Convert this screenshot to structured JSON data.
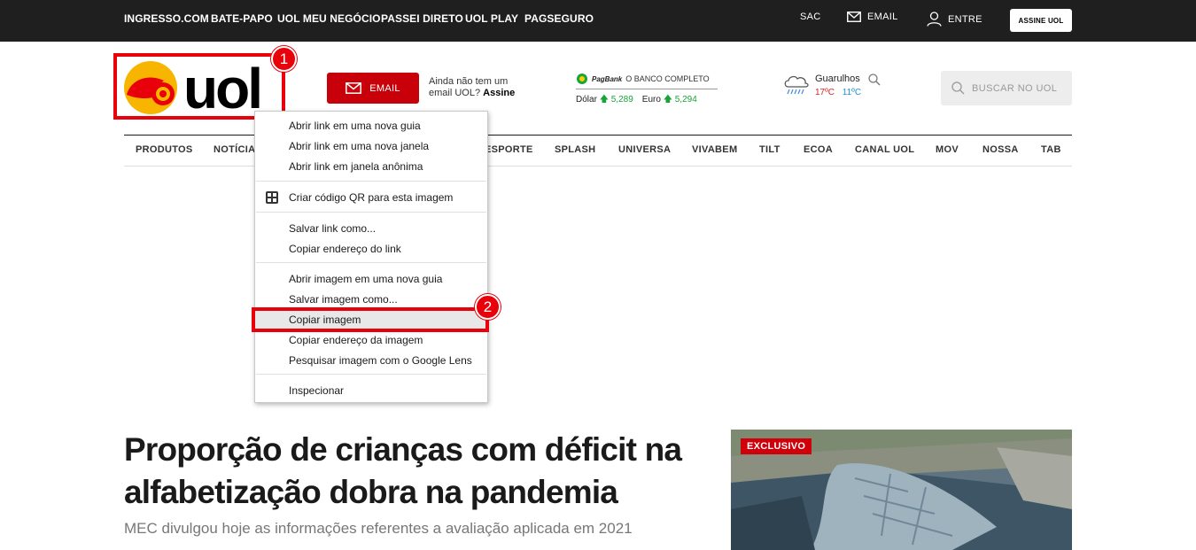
{
  "topbar": {
    "links": [
      "INGRESSO.COM",
      "BATE-PAPO",
      "UOL MEU NEGÓCIO",
      "PASSEI DIRETO",
      "UOL PLAY",
      "PAGSEGURO"
    ],
    "sac": "SAC",
    "email": "EMAIL",
    "entre": "ENTRE",
    "assine": "ASSINE UOL"
  },
  "header": {
    "logo_text": "uol",
    "email_button": "EMAIL",
    "email_promo_line1": "Ainda não tem um",
    "email_promo_line2": "email UOL?",
    "email_promo_cta": "Assine",
    "bank_brand": "PagBank",
    "bank_tagline": "O BANCO COMPLETO",
    "dolar_label": "Dólar",
    "dolar_value": "5,289",
    "euro_label": "Euro",
    "euro_value": "5,294",
    "weather_city": "Guarulhos",
    "temp_max": "17ºC",
    "temp_min": "11ºC",
    "search_label": "BUSCAR NO UOL"
  },
  "nav": [
    "PRODUTOS",
    "NOTÍCIA",
    "ESPORTE",
    "SPLASH",
    "UNIVERSA",
    "VIVABEM",
    "TILT",
    "ECOA",
    "CANAL UOL",
    "MOV",
    "NOSSA",
    "TAB"
  ],
  "article": {
    "headline": "Proporção de crianças com déficit na alfabetização dobra na pandemia",
    "subhead": "MEC divulgou hoje as informações referentes a avaliação aplicada em 2021",
    "tag": "EXCLUSIVO"
  },
  "context_menu": {
    "items": [
      "Abrir link em uma nova guia",
      "Abrir link em uma nova janela",
      "Abrir link em janela anônima",
      "Criar código QR para esta imagem",
      "Salvar link como...",
      "Copiar endereço do link",
      "Abrir imagem em uma nova guia",
      "Salvar imagem como...",
      "Copiar imagem",
      "Copiar endereço da imagem",
      "Pesquisar imagem com o Google Lens",
      "Inspecionar"
    ]
  },
  "annotations": {
    "badge1": "1",
    "badge2": "2"
  },
  "colors": {
    "topbar": "#1f1f1f",
    "brand_red": "#c8000a",
    "highlight": "#e8000b",
    "logo_yellow": "#f7b500"
  }
}
